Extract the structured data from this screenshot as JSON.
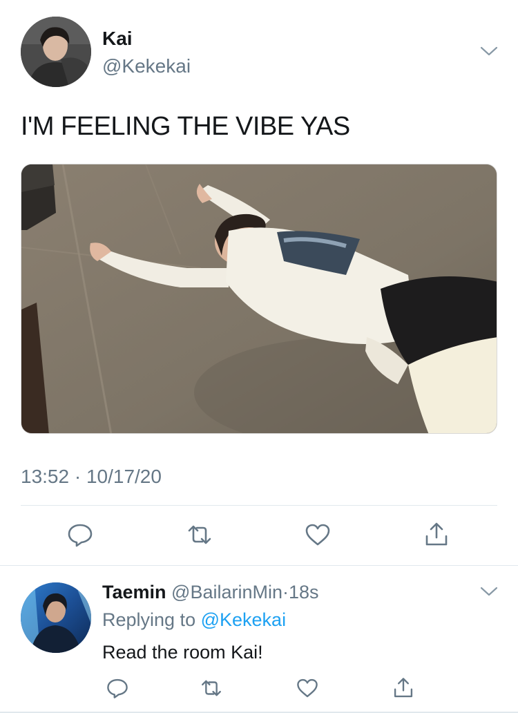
{
  "tweet": {
    "author_name": "Kai",
    "author_handle": "@Kekekai",
    "text": "I'M FEELING THE VIBE YAS",
    "timestamp": "13:52 · 10/17/20"
  },
  "reply": {
    "author_name": "Taemin",
    "author_handle": "@BailarinMin",
    "separator": "·",
    "time": "18s",
    "replying_prefix": "Replying to",
    "replying_handle": "@Kekekai",
    "text": "Read the room Kai!"
  },
  "icons": {
    "reply": "reply-bubble-icon",
    "retweet": "retweet-icon",
    "like": "heart-icon",
    "share": "share-icon",
    "more": "chevron-down-icon"
  },
  "colors": {
    "icon_gray": "#657786",
    "link_blue": "#1da1f2",
    "text": "#14171a",
    "divider": "#e1e8ed"
  }
}
